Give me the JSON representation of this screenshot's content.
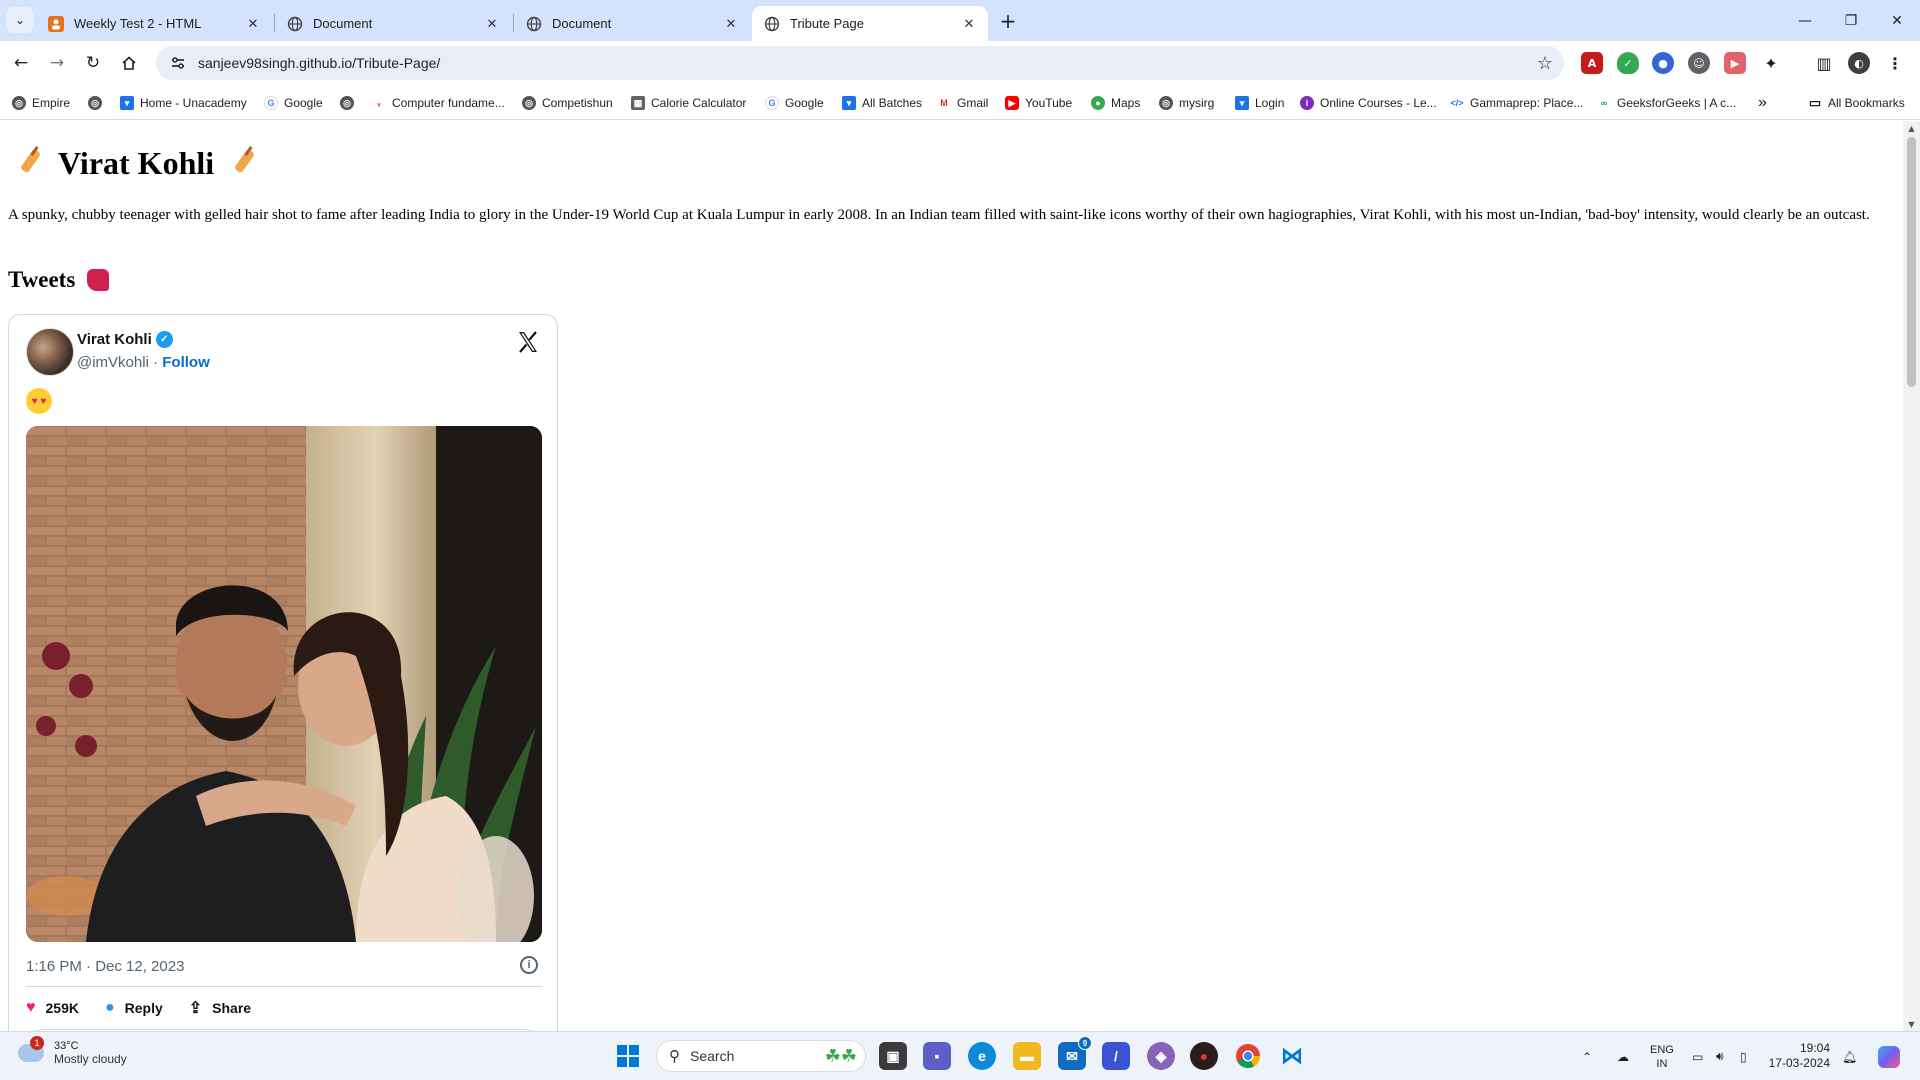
{
  "browser": {
    "tabs": [
      {
        "title": "Weekly Test 2 - HTML",
        "active": false
      },
      {
        "title": "Document",
        "active": false
      },
      {
        "title": "Document",
        "active": false
      },
      {
        "title": "Tribute Page",
        "active": true
      }
    ],
    "new_tab": "+",
    "url": "sanjeev98singh.github.io/Tribute-Page/",
    "bookmarks": [
      "Empire",
      "",
      "Home - Unacademy",
      "Google",
      "",
      "Computer fundame...",
      "Competishun",
      "Calorie Calculator",
      "Google",
      "All Batches",
      "Gmail",
      "YouTube",
      "Maps",
      "mysirg",
      "Login",
      "Online Courses - Le...",
      "Gammaprep: Place...",
      "GeeksforGeeks | A c..."
    ],
    "bookmarks_overflow": "»",
    "all_bookmarks": "All Bookmarks"
  },
  "page": {
    "title": "Virat Kohli",
    "bio": "A spunky, chubby teenager with gelled hair shot to fame after leading India to glory in the Under-19 World Cup at Kuala Lumpur in early 2008. In an Indian team filled with saint-like icons worthy of their own hagiographies, Virat Kohli, with his most un-Indian, 'bad-boy' intensity, would clearly be an outcast.",
    "tweets_heading": "Tweets"
  },
  "tweet": {
    "name": "Virat Kohli",
    "handle": "@imVkohli",
    "separator": "·",
    "follow": "Follow",
    "timestamp": "1:16 PM · Dec 12, 2023",
    "likes": "259K",
    "reply": "Reply",
    "share": "Share"
  },
  "taskbar": {
    "temperature": "33°C",
    "weather": "Mostly cloudy",
    "weather_badge": "1",
    "search_placeholder": "Search",
    "mail_badge": "9",
    "lang1": "ENG",
    "lang2": "IN",
    "time": "19:04",
    "date": "17-03-2024"
  },
  "colors": {
    "tabstrip": "#d3e3fd",
    "link_blue": "#006fd6",
    "verified": "#1d9bf0",
    "like_pink": "#f91880"
  }
}
